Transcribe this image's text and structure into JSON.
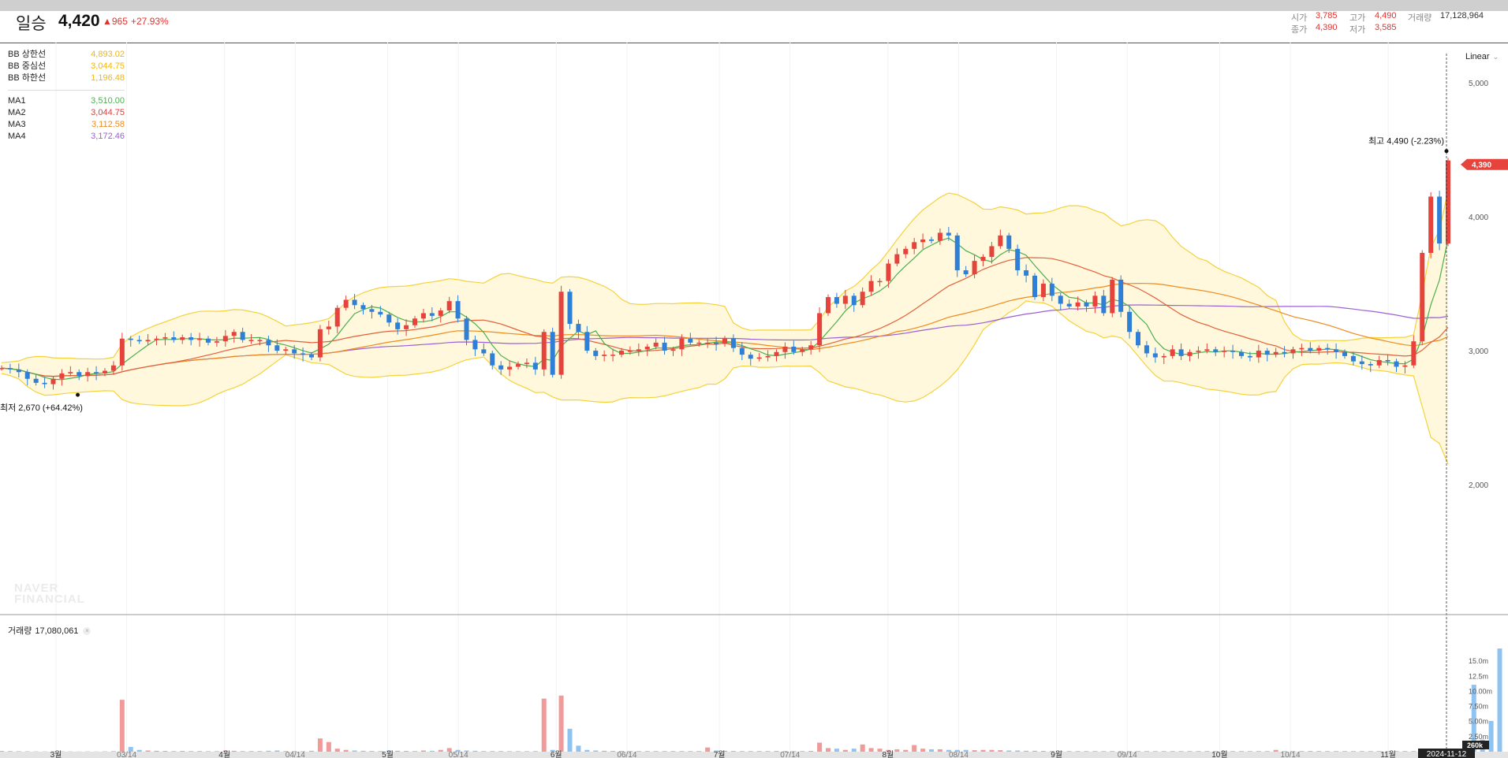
{
  "header": {
    "name": "일승",
    "price": "4,420",
    "change": "▲965",
    "rate": "+27.93%",
    "open_label": "시가",
    "open": "3,785",
    "high_label": "고가",
    "high": "4,490",
    "volume_label": "거래량",
    "volume": "17,128,964",
    "close_label": "종가",
    "close": "4,390",
    "low_label": "저가",
    "low": "3,585"
  },
  "legend": {
    "items": [
      {
        "name": "BB 상한선",
        "value": "4,893.02",
        "color": "#f2b705"
      },
      {
        "name": "BB 중심선",
        "value": "3,044.75",
        "color": "#f2b705"
      },
      {
        "name": "BB 하한선",
        "value": "1,196.48",
        "color": "#f2b705"
      },
      {
        "name": "MA1",
        "value": "3,510.00",
        "color": "#4caf50"
      },
      {
        "name": "MA2",
        "value": "3,044.75",
        "color": "#e53935"
      },
      {
        "name": "MA3",
        "value": "3,112.58",
        "color": "#ef8a1e"
      },
      {
        "name": "MA4",
        "value": "3,172.46",
        "color": "#9c5fd6"
      }
    ]
  },
  "scale_label": "Linear",
  "volume_panel": {
    "label": "거래량",
    "value": "17,080,061"
  },
  "watermark": "NAVER\nFINANCIAL",
  "colors": {
    "up": "#e5433c",
    "down": "#2f7fd6",
    "band_fill": "#fff8dc",
    "band_line": "#f4d23c"
  },
  "chart_data": {
    "type": "candlestick",
    "x_tick_labels": [
      "3월",
      "03/14",
      "4월",
      "04/14",
      "5월",
      "05/14",
      "6월",
      "06/14",
      "7월",
      "07/14",
      "8월",
      "08/14",
      "9월",
      "09/14",
      "10월",
      "10/14",
      "11월"
    ],
    "x_tick_major": [
      true,
      false,
      true,
      false,
      true,
      false,
      true,
      false,
      true,
      false,
      true,
      false,
      true,
      false,
      true,
      false,
      true
    ],
    "x_tick_dates": [
      "2024-03-01",
      "2024-03-14",
      "2024-04-01",
      "2024-04-14",
      "2024-05-01",
      "2024-05-14",
      "2024-06-01",
      "2024-06-14",
      "2024-07-01",
      "2024-07-14",
      "2024-08-01",
      "2024-08-14",
      "2024-09-01",
      "2024-09-14",
      "2024-10-01",
      "2024-10-14",
      "2024-11-01"
    ],
    "cursor_date": "2024-11-12",
    "y_ticks": [
      "2,000",
      "3,000",
      "4,000",
      "5,000"
    ],
    "y_tick_values": [
      2000,
      3000,
      4000,
      5000
    ],
    "ylim": [
      1030,
      5300
    ],
    "last_price_label": "4,390",
    "last_price": 4390,
    "max_label": "최고 4,490 (-2.23%)",
    "max_value": 4490,
    "min_label": "최저 2,670 (+64.42%)",
    "min_value": 2670,
    "volume_ticks": [
      "15.0m",
      "12.5m",
      "10.00m",
      "7.50m",
      "5.00m",
      "2.50m"
    ],
    "volume_tick_values": [
      15,
      12.5,
      10,
      7.5,
      5,
      2.5
    ],
    "volume_ylim": [
      0,
      17.5
    ],
    "volume_cursor_label": "260k",
    "closes": [
      2870,
      2860,
      2840,
      2790,
      2760,
      2750,
      2790,
      2830,
      2840,
      2810,
      2840,
      2830,
      2850,
      2890,
      3090,
      3080,
      3070,
      3080,
      3090,
      3100,
      3080,
      3100,
      3080,
      3090,
      3060,
      3070,
      3110,
      3140,
      3080,
      3080,
      3080,
      3040,
      3000,
      3010,
      2980,
      2970,
      2950,
      3160,
      3180,
      3320,
      3380,
      3340,
      3310,
      3290,
      3270,
      3210,
      3160,
      3190,
      3240,
      3280,
      3260,
      3300,
      3370,
      3240,
      3080,
      3010,
      2980,
      2890,
      2860,
      2880,
      2900,
      2910,
      2860,
      3140,
      2820,
      3440,
      3200,
      3140,
      3000,
      2960,
      2970,
      2970,
      3000,
      3000,
      3010,
      3030,
      3060,
      3000,
      3010,
      3090,
      3060,
      3060,
      3060,
      3050,
      3090,
      3020,
      2970,
      2940,
      2950,
      2960,
      2990,
      3030,
      2990,
      3010,
      3040,
      3280,
      3400,
      3350,
      3410,
      3340,
      3440,
      3520,
      3520,
      3650,
      3720,
      3760,
      3810,
      3830,
      3820,
      3880,
      3860,
      3600,
      3570,
      3670,
      3700,
      3780,
      3860,
      3760,
      3600,
      3560,
      3400,
      3500,
      3410,
      3350,
      3330,
      3360,
      3330,
      3410,
      3280,
      3530,
      3290,
      3140,
      3040,
      2980,
      2950,
      2960,
      3010,
      2960,
      2990,
      3000,
      3010,
      2990,
      3000,
      2990,
      2960,
      2950,
      3000,
      2970,
      2990,
      2980,
      3010,
      3020,
      3000,
      3020,
      3010,
      2990,
      2960,
      2920,
      2900,
      2890,
      2930,
      2920,
      2880,
      2890,
      3070,
      3730,
      4150,
      3800,
      4420
    ],
    "volumes": [
      0.12,
      0.1,
      0.08,
      0.06,
      0.05,
      0.04,
      0.05,
      0.05,
      0.04,
      0.03,
      0.04,
      0.03,
      0.05,
      0.08,
      8.6,
      0.8,
      0.3,
      0.2,
      0.15,
      0.12,
      0.1,
      0.12,
      0.1,
      0.1,
      0.08,
      0.08,
      0.2,
      0.15,
      0.1,
      0.1,
      0.1,
      0.15,
      0.2,
      0.1,
      0.1,
      0.08,
      0.15,
      2.2,
      1.6,
      0.5,
      0.3,
      0.2,
      0.15,
      0.12,
      0.1,
      0.2,
      0.15,
      0.12,
      0.1,
      0.2,
      0.15,
      0.3,
      0.6,
      0.3,
      0.2,
      0.15,
      0.1,
      0.1,
      0.1,
      0.08,
      0.08,
      0.08,
      0.1,
      8.8,
      0.3,
      9.3,
      3.8,
      1.0,
      0.3,
      0.2,
      0.15,
      0.12,
      0.12,
      0.1,
      0.1,
      0.1,
      0.1,
      0.1,
      0.1,
      0.1,
      0.1,
      0.1,
      0.7,
      0.2,
      0.15,
      0.12,
      0.1,
      0.1,
      0.1,
      0.1,
      0.12,
      0.1,
      0.1,
      0.1,
      0.12,
      1.5,
      0.6,
      0.5,
      0.3,
      0.5,
      1.2,
      0.6,
      0.5,
      0.3,
      0.4,
      0.3,
      1.1,
      0.5,
      0.4,
      0.4,
      0.3,
      0.3,
      0.3,
      0.25,
      0.3,
      0.3,
      0.25,
      0.2,
      0.2,
      0.15,
      0.15,
      0.12,
      0.12,
      0.1,
      0.1,
      0.1,
      0.1,
      0.1,
      0.1,
      0.1,
      0.1,
      0.1,
      0.1,
      0.1,
      0.1,
      0.1,
      0.1,
      0.1,
      0.1,
      0.1,
      0.1,
      0.1,
      0.1,
      0.1,
      0.1,
      0.1,
      0.1,
      0.1,
      0.3,
      0.1,
      0.1,
      0.1,
      0.12,
      0.1,
      0.1,
      0.1,
      0.1,
      0.1,
      0.1,
      0.1,
      0.1,
      0.1,
      0.1,
      0.1,
      0.1,
      0.1,
      0.1,
      0.15,
      0.1,
      0.12,
      0.1,
      11.1,
      2.0,
      5.1,
      17.1
    ]
  }
}
